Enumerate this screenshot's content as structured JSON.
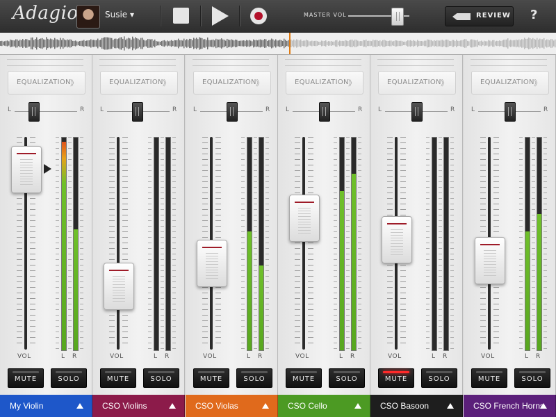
{
  "app": {
    "logo": "Adagio",
    "user": "Susie ▾"
  },
  "transport": {
    "stop_icon": "stop-icon",
    "play_icon": "play-icon",
    "record_icon": "record-icon"
  },
  "master": {
    "label": "MASTER VOL",
    "level": 0.8
  },
  "review": {
    "label": "REVIEW"
  },
  "help": {
    "label": "?"
  },
  "playhead_position": 0.52,
  "channel_labels": {
    "eq": "EQUALIZATION",
    "eq_arrow": "》",
    "pan_left": "L",
    "pan_right": "R",
    "vol": "VOL",
    "meter_left": "L",
    "meter_right": "R",
    "mute": "MUTE",
    "solo": "SOLO"
  },
  "channels": [
    {
      "name": "My Violin",
      "color": "#1e57c9",
      "pan": 0.3,
      "fader": 0.85,
      "meter_l": 0.98,
      "meter_r": 0.57,
      "mute": false,
      "selected": true
    },
    {
      "name": "CSO Violins",
      "color": "#8c1b4a",
      "pan": 0.48,
      "fader": 0.3,
      "meter_l": 0.0,
      "meter_r": 0.0,
      "mute": false,
      "selected": false
    },
    {
      "name": "CSO Violas",
      "color": "#e06a1c",
      "pan": 0.5,
      "fader": 0.41,
      "meter_l": 0.56,
      "meter_r": 0.4,
      "mute": false,
      "selected": false
    },
    {
      "name": "CSO Cello",
      "color": "#4c9a23",
      "pan": 0.5,
      "fader": 0.62,
      "meter_l": 0.75,
      "meter_r": 0.83,
      "mute": false,
      "selected": false
    },
    {
      "name": "CSO Basoon",
      "color": "#1e1e1e",
      "pan": 0.5,
      "fader": 0.52,
      "meter_l": 0.0,
      "meter_r": 0.0,
      "mute": true,
      "selected": false
    },
    {
      "name": "CSO French Horns",
      "color": "#5b1f7a",
      "pan": 0.5,
      "fader": 0.42,
      "meter_l": 0.56,
      "meter_r": 0.64,
      "mute": false,
      "selected": false
    }
  ]
}
